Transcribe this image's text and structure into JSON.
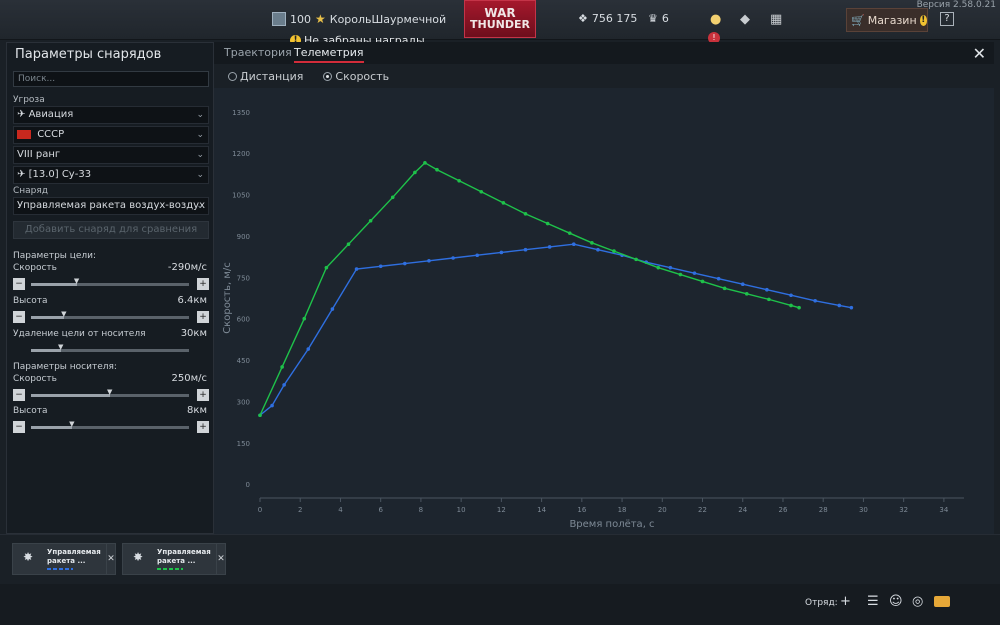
{
  "topbar": {
    "version": "Версия 2.58.0.21",
    "level": "100",
    "username": "КорольШаурмечной",
    "logo_line1": "WAR",
    "logo_line2": "THUNDER",
    "rewards_notice": "Не забраны награды",
    "silver": "756 175",
    "gold": "6",
    "shop_label": "Магазин",
    "help_label": "?"
  },
  "left_panel": {
    "title": "Параметры снарядов",
    "search_placeholder": "Поиск...",
    "threat_label": "Угроза",
    "threat_value": "Авиация",
    "country_value": "СССР",
    "rank_value": "VIII ранг",
    "vehicle_value": "[13.0] Су-33",
    "shell_label": "Снаряд",
    "shell_value": "Управляемая ракета воздух-воздух Р-",
    "add_button": "Добавить снаряд для сравнения",
    "target_params_label": "Параметры цели:",
    "carrier_params_label": "Параметры носителя:",
    "params": [
      {
        "label": "Скорость",
        "value": "-290м/с",
        "fill": 0.29
      },
      {
        "label": "Высота",
        "value": "6.4км",
        "fill": 0.21
      },
      {
        "label": "Удаление цели от носителя",
        "value": "30км",
        "fill": 0.19
      },
      {
        "label": "Скорость",
        "value": "250м/с",
        "fill": 0.5
      },
      {
        "label": "Высота",
        "value": "8км",
        "fill": 0.26
      }
    ]
  },
  "tabs": {
    "trajectory": "Траектория",
    "telemetry": "Телеметрия",
    "close": "✕"
  },
  "radios": {
    "distance": "Дистанция",
    "speed": "Скорость"
  },
  "chart_data": {
    "type": "line",
    "xlabel": "Время полёта, с",
    "ylabel": "Скорость, м/с",
    "xlim": [
      0,
      35
    ],
    "ylim": [
      -50,
      1400
    ],
    "x_ticks": [
      0,
      2,
      4,
      6,
      8,
      10,
      12,
      14,
      16,
      18,
      20,
      22,
      24,
      26,
      28,
      30,
      32,
      34
    ],
    "y_ticks": [
      0,
      150,
      300,
      450,
      600,
      750,
      900,
      1050,
      1200,
      1350
    ],
    "grid": false,
    "series": [
      {
        "color": "#2f6fe0",
        "x": [
          0,
          0.6,
          1.2,
          2.4,
          3.6,
          4.8,
          6,
          7.2,
          8.4,
          9.6,
          10.8,
          12,
          13.2,
          14.4,
          15.6,
          16.8,
          18,
          19.2,
          20.4,
          21.6,
          22.8,
          24,
          25.2,
          26.4,
          27.6,
          28.8,
          29.4
        ],
        "y": [
          250,
          285,
          360,
          490,
          635,
          780,
          790,
          800,
          810,
          820,
          830,
          840,
          850,
          860,
          870,
          850,
          830,
          805,
          785,
          765,
          745,
          725,
          705,
          685,
          665,
          648,
          640
        ]
      },
      {
        "color": "#1ec24a",
        "x": [
          0,
          1.1,
          2.2,
          3.3,
          4.4,
          5.5,
          6.6,
          7.7,
          8.2,
          8.8,
          9.9,
          11,
          12.1,
          13.2,
          14.3,
          15.4,
          16.5,
          17.6,
          18.7,
          19.8,
          20.9,
          22,
          23.1,
          24.2,
          25.3,
          26.4,
          26.8
        ],
        "y": [
          250,
          425,
          600,
          785,
          870,
          955,
          1040,
          1130,
          1165,
          1140,
          1100,
          1060,
          1020,
          980,
          945,
          910,
          875,
          845,
          815,
          785,
          760,
          735,
          710,
          690,
          670,
          648,
          640
        ]
      }
    ]
  },
  "comparison_cards": [
    {
      "title_line1": "Управляемая",
      "title_line2": "ракета ...",
      "color": "#2f6fe0"
    },
    {
      "title_line1": "Управляемая",
      "title_line2": "ракета ...",
      "color": "#1ec24a"
    }
  ],
  "footer": {
    "squad_label": "Отряд:"
  }
}
